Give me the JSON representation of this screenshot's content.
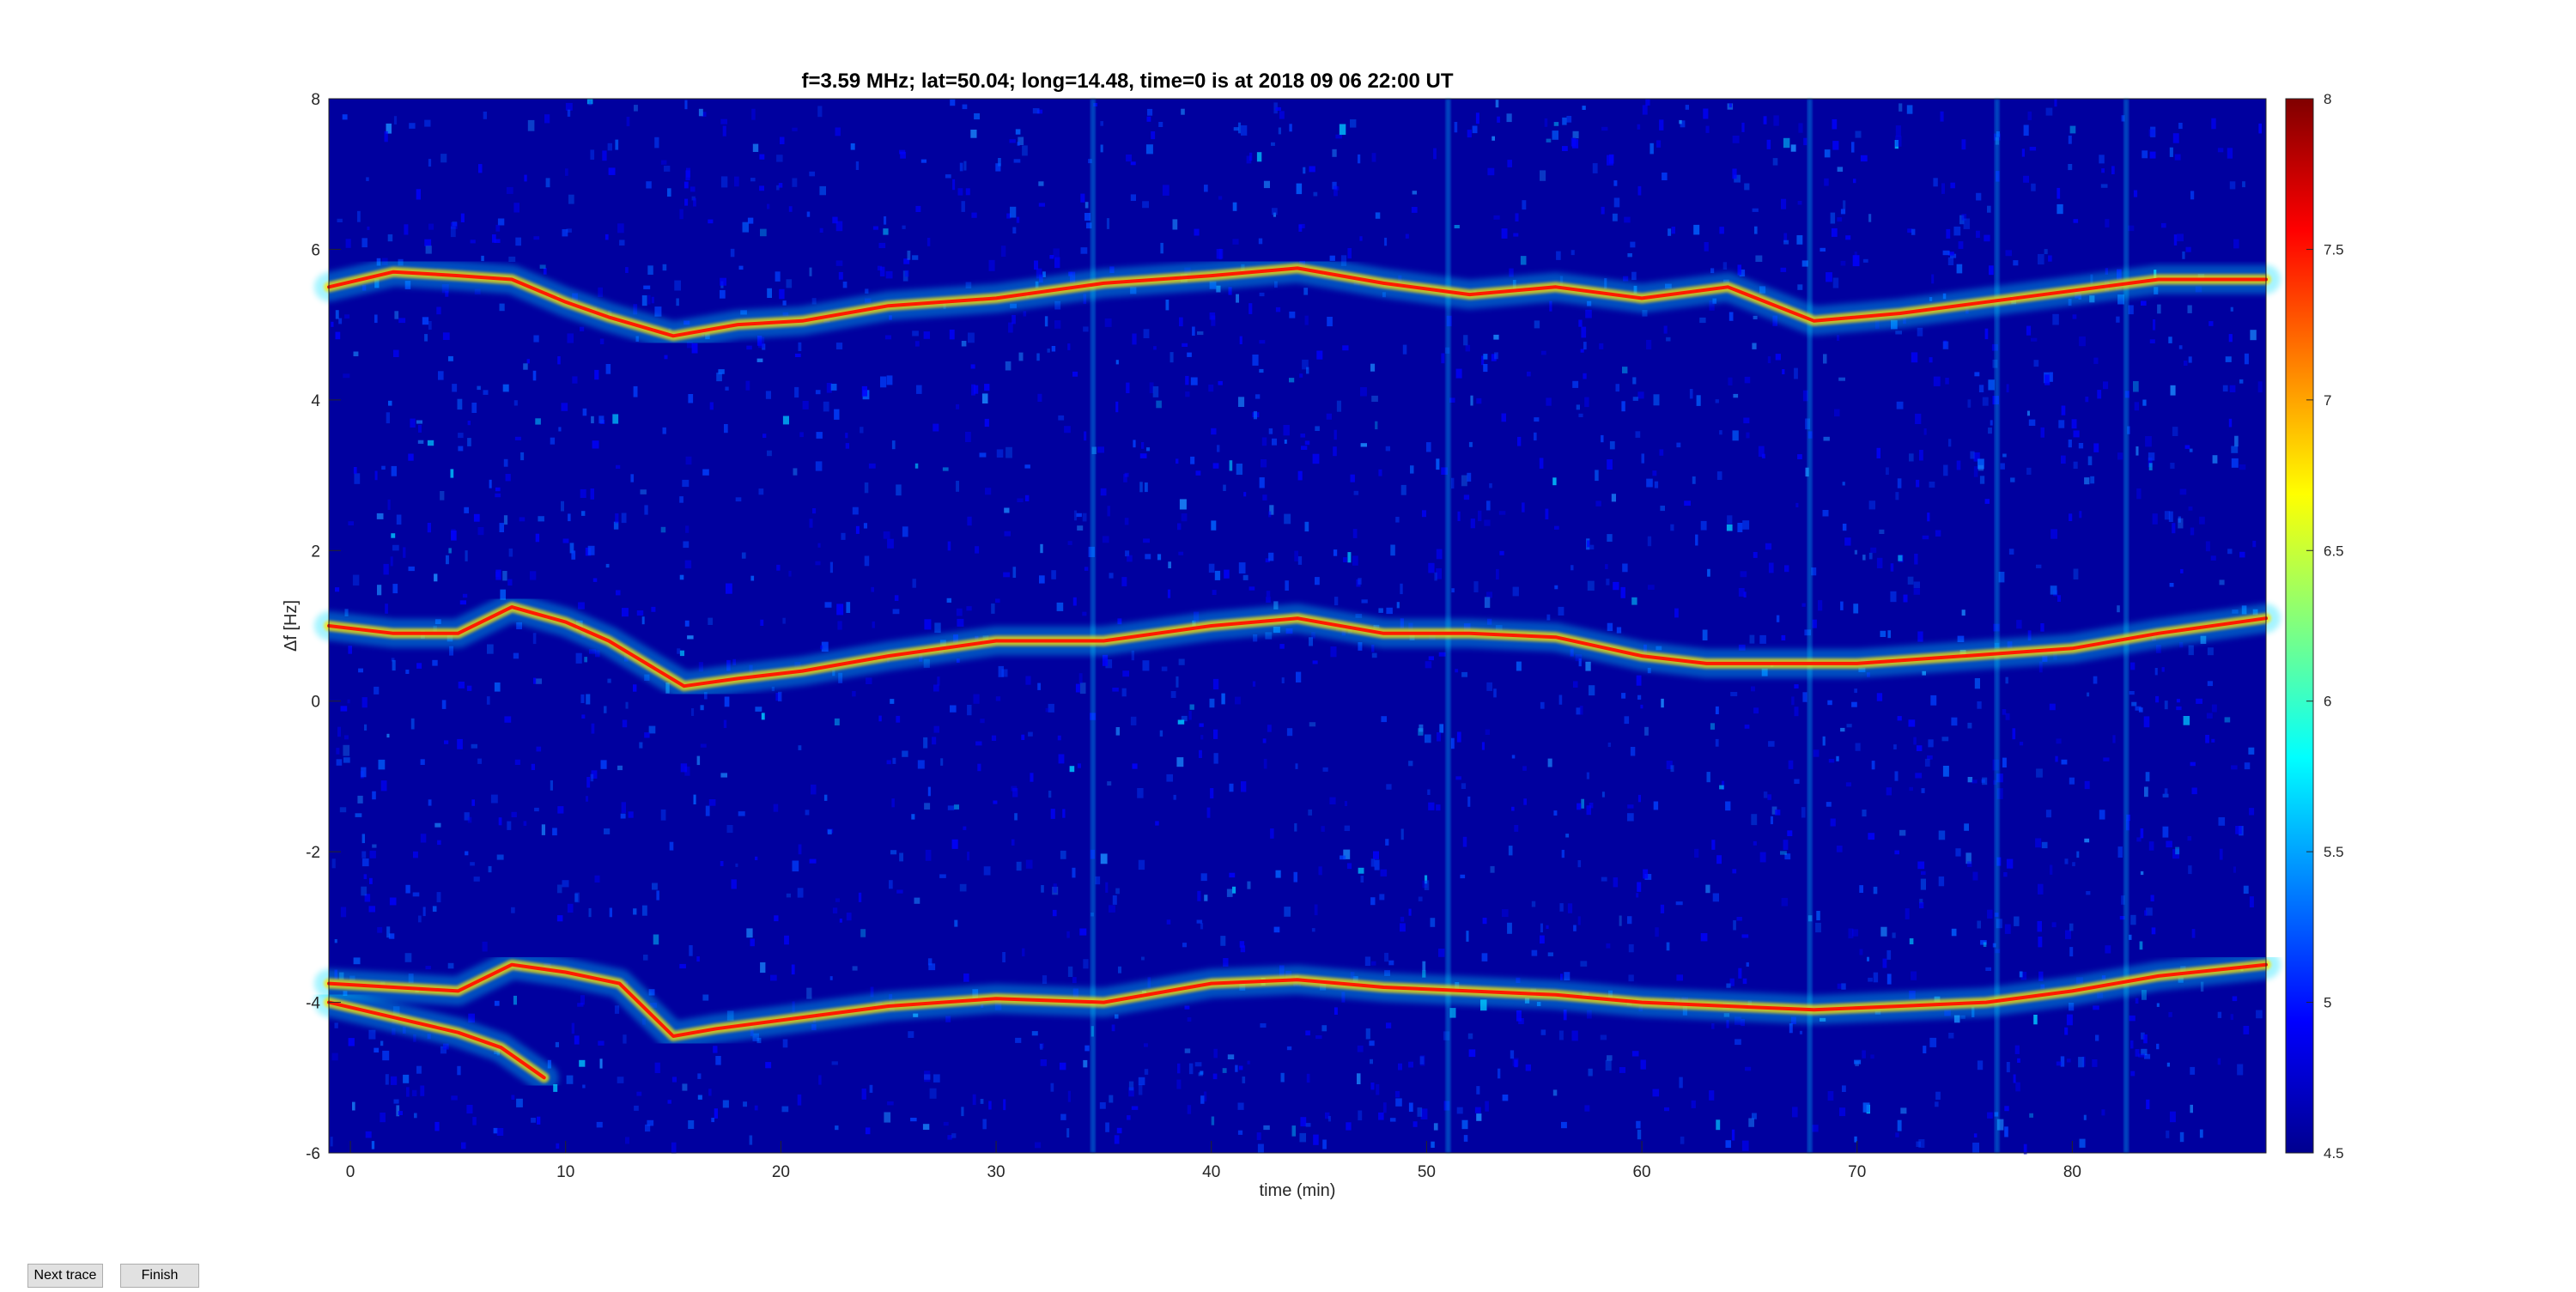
{
  "chart_data": {
    "type": "heatmap",
    "title": "f=3.59 MHz;  lat=50.04; long=14.48, time=0 is at 2018 09 06 22:00 UT",
    "xlabel": "time (min)",
    "ylabel": "Δf [Hz]",
    "xlim": [
      -1,
      89
    ],
    "ylim": [
      -6,
      8
    ],
    "xticks": [
      0,
      10,
      20,
      30,
      40,
      50,
      60,
      70,
      80
    ],
    "yticks": [
      -6,
      -4,
      -2,
      0,
      2,
      4,
      6,
      8
    ],
    "colorbar": {
      "range": [
        4.5,
        8
      ],
      "ticks": [
        "4.5",
        "5",
        "5.5",
        "6",
        "6.5",
        "7",
        "7.5",
        "8"
      ],
      "colormap": "jet"
    },
    "background_color": "#00009f",
    "series": [
      {
        "x": [
          -1,
          2,
          5,
          7.5,
          10,
          12,
          15,
          18,
          21,
          25,
          30,
          35,
          40,
          44,
          48,
          52,
          56,
          60,
          64,
          68,
          72,
          76,
          80,
          84,
          89
        ],
        "values": [
          5.5,
          5.7,
          5.65,
          5.6,
          5.3,
          5.1,
          4.85,
          5.0,
          5.05,
          5.25,
          5.35,
          5.55,
          5.65,
          5.75,
          5.55,
          5.4,
          5.5,
          5.35,
          5.5,
          5.05,
          5.15,
          5.3,
          5.45,
          5.6,
          5.6
        ]
      },
      {
        "x": [
          -1,
          2,
          5,
          7.5,
          10,
          12,
          15.5,
          18,
          21,
          25,
          30,
          35,
          40,
          44,
          48,
          52,
          56,
          60,
          63,
          66,
          70,
          75,
          80,
          84,
          89
        ],
        "values": [
          1.0,
          0.9,
          0.9,
          1.25,
          1.05,
          0.8,
          0.2,
          0.3,
          0.4,
          0.6,
          0.8,
          0.8,
          1.0,
          1.1,
          0.9,
          0.9,
          0.85,
          0.6,
          0.5,
          0.5,
          0.5,
          0.6,
          0.7,
          0.9,
          1.1
        ]
      },
      {
        "x": [
          -1,
          2,
          5,
          7.5,
          10,
          12.5,
          15,
          17,
          21,
          25,
          30,
          35,
          40,
          44,
          48,
          52,
          56,
          60,
          64,
          68,
          72,
          76,
          80,
          84,
          89
        ],
        "values": [
          -3.75,
          -3.8,
          -3.85,
          -3.5,
          -3.6,
          -3.75,
          -4.45,
          -4.35,
          -4.2,
          -4.05,
          -3.95,
          -4.0,
          -3.75,
          -3.7,
          -3.8,
          -3.85,
          -3.9,
          -4.0,
          -4.05,
          -4.1,
          -4.05,
          -4.0,
          -3.85,
          -3.65,
          -3.5
        ]
      },
      {
        "x": [
          -1,
          2,
          5,
          7,
          9
        ],
        "values": [
          -4.0,
          -4.2,
          -4.4,
          -4.6,
          -5.0
        ]
      }
    ]
  },
  "controls": {
    "next_trace": "Next trace",
    "finish": "Finish"
  }
}
